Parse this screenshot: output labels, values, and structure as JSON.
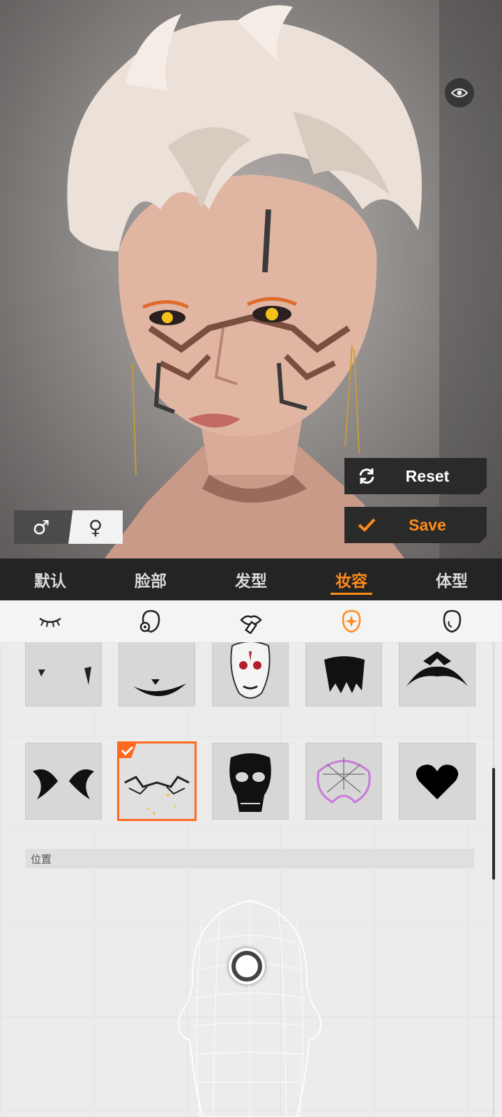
{
  "viewport": {
    "eye_icon": "eye-icon"
  },
  "actions": {
    "reset_label": "Reset",
    "save_label": "Save",
    "reset_icon": "refresh-icon",
    "save_icon": "check-icon"
  },
  "gender": {
    "male_symbol": "♂",
    "female_symbol": "♀",
    "selected": "female"
  },
  "tabs": [
    {
      "label": "默认"
    },
    {
      "label": "脸部"
    },
    {
      "label": "发型"
    },
    {
      "label": "妆容",
      "active": true
    },
    {
      "label": "体型"
    }
  ],
  "subtabs": [
    {
      "icon": "eyelash-icon"
    },
    {
      "icon": "face-makeup-icon"
    },
    {
      "icon": "lipstick-icon"
    },
    {
      "icon": "face-paint-icon",
      "active": true
    },
    {
      "icon": "face-outline-icon"
    }
  ],
  "makeup_grid": {
    "row1": [
      "fang-marks",
      "smile-mouth",
      "kitsune-mask",
      "drip-jaw",
      "tribal-crown"
    ],
    "row2": [
      "tribal-eyes",
      "cyber-lines",
      "skull-mask",
      "spiderweb-mask",
      "heart"
    ],
    "selected": "cyber-lines"
  },
  "position_section": {
    "label": "位置"
  },
  "colors": {
    "accent": "#ff8a1c",
    "selection": "#ff6a1f",
    "tabbar_bg": "#242424",
    "button_bg": "#2a2a2a"
  }
}
